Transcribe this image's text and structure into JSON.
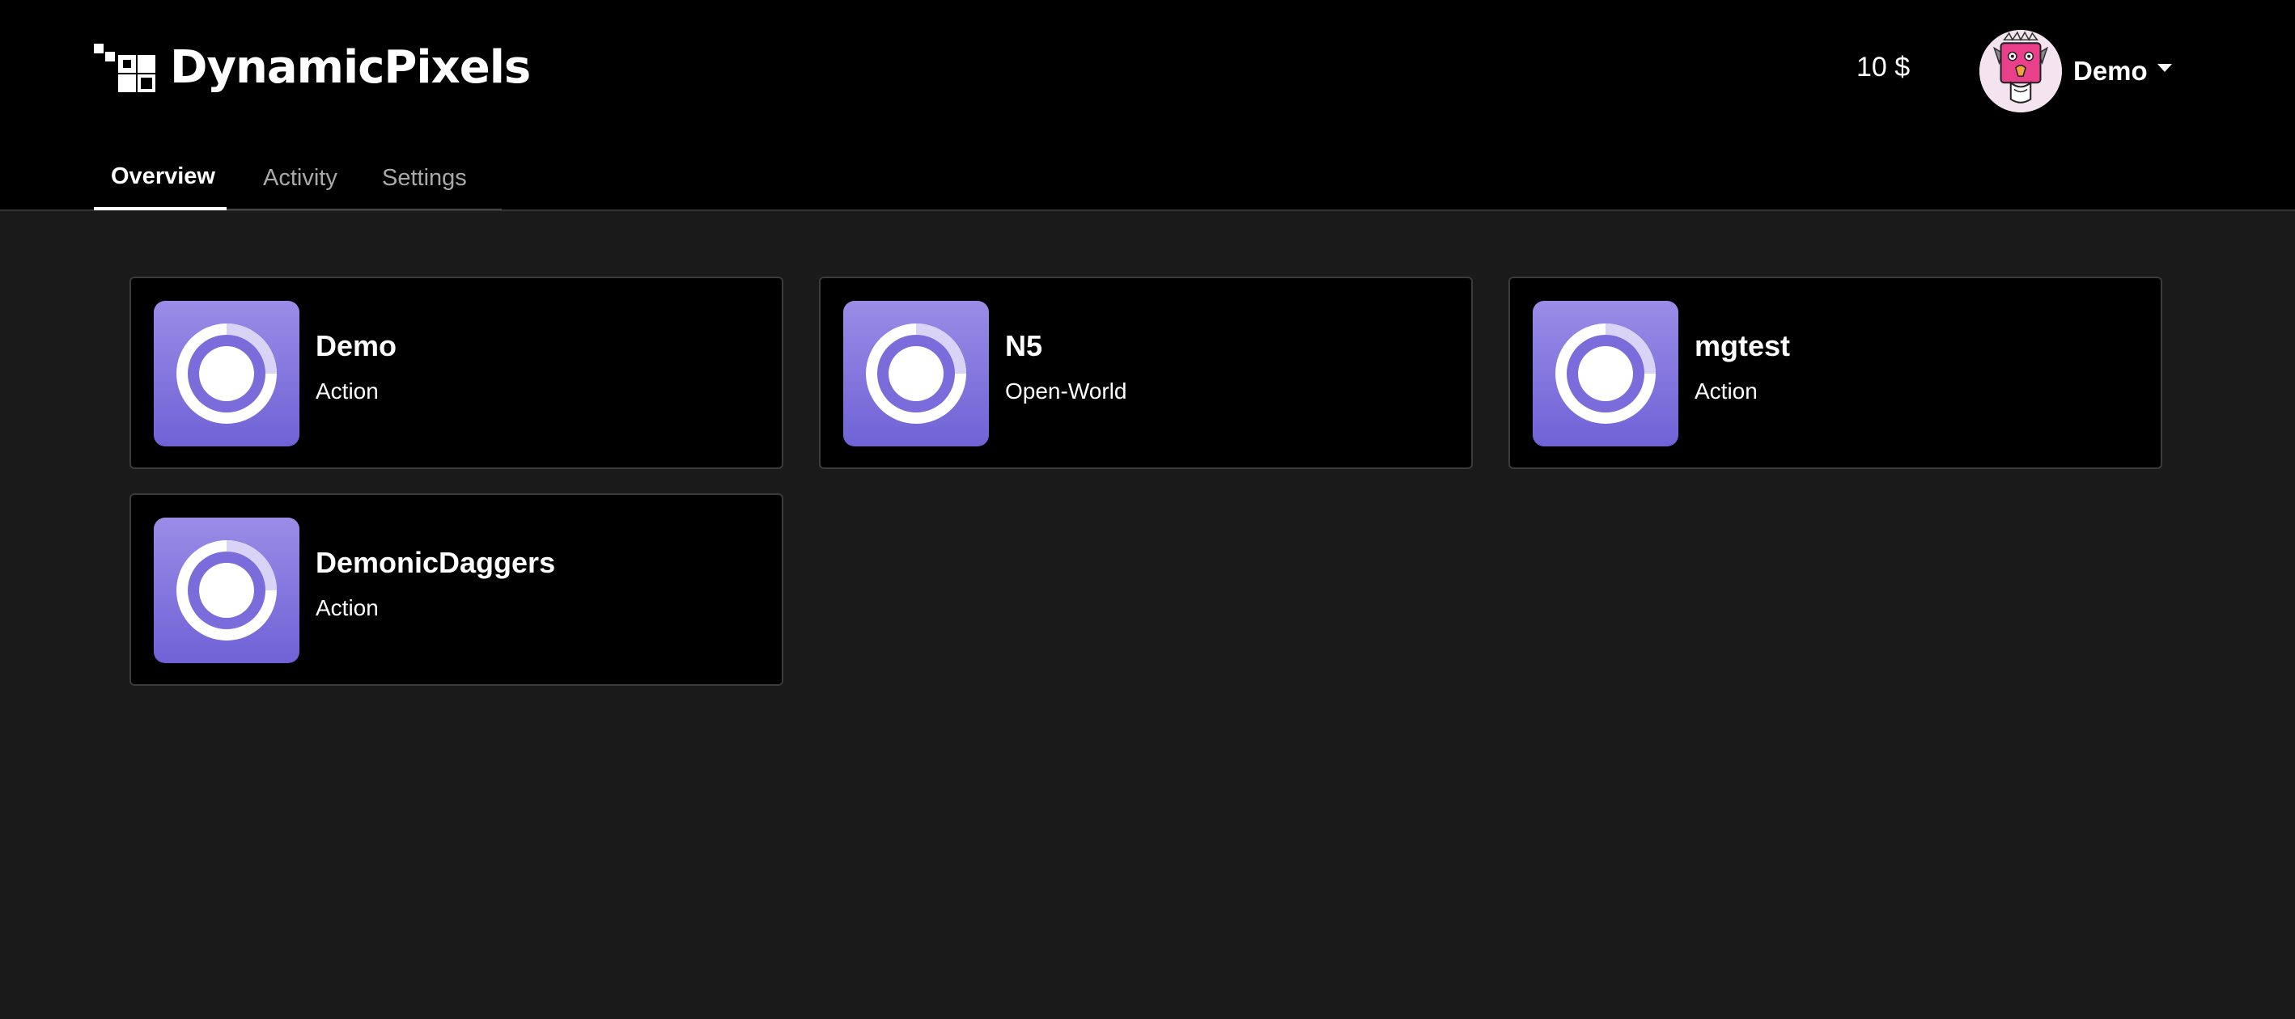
{
  "brand": {
    "name": "DynamicPixels",
    "logo_icon": "pixel-blocks-logo"
  },
  "header": {
    "balance": "10 $",
    "user": {
      "name": "Demo",
      "avatar_icon": "monster-avatar"
    }
  },
  "tabs": [
    {
      "label": "Overview",
      "active": true
    },
    {
      "label": "Activity",
      "active": false
    },
    {
      "label": "Settings",
      "active": false
    }
  ],
  "projects": [
    {
      "name": "Demo",
      "genre": "Action",
      "icon": "ring-app-icon"
    },
    {
      "name": "N5",
      "genre": "Open-World",
      "icon": "ring-app-icon"
    },
    {
      "name": "mgtest",
      "genre": "Action",
      "icon": "ring-app-icon"
    },
    {
      "name": "DemonicDaggers",
      "genre": "Action",
      "icon": "ring-app-icon"
    }
  ],
  "colors": {
    "page_background": "#1a1a1a",
    "topbar_background": "#000000",
    "card_background": "#000000",
    "card_border": "#3b3b3b",
    "icon_gradient_top": "#9a8ce6",
    "icon_gradient_bottom": "#6f62d6",
    "tab_inactive": "#a9a9a9"
  }
}
